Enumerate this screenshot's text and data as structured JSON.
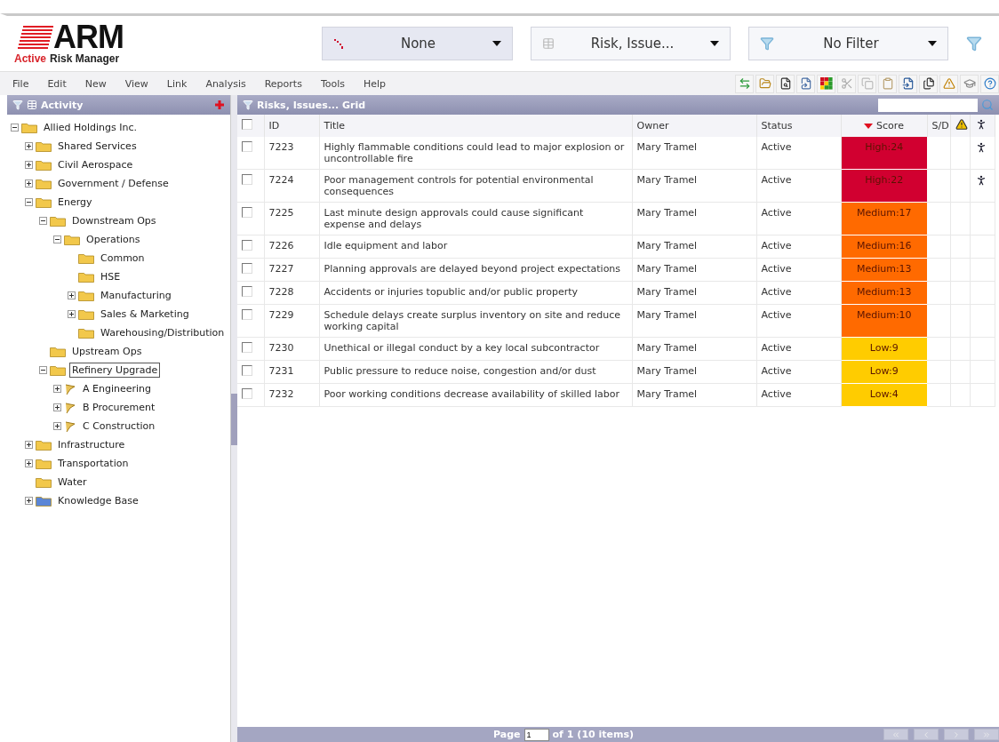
{
  "logo": {
    "mark": "ARM",
    "tagline_1": "Active",
    "tagline_2": "Risk Manager"
  },
  "selectors": [
    {
      "kind": "dots",
      "label": "None",
      "pressed": true
    },
    {
      "kind": "grid",
      "label": "Risk, Issue...",
      "pressed": false
    },
    {
      "kind": "filter",
      "label": "No Filter",
      "pressed": false
    }
  ],
  "menu": [
    "File",
    "Edit",
    "New",
    "View",
    "Link",
    "Analysis",
    "Reports",
    "Tools",
    "Help"
  ],
  "left_panel": {
    "title": "Activity"
  },
  "tree": [
    {
      "label": "Allied Holdings Inc.",
      "kind": "folder",
      "expanded": true,
      "selected": false,
      "children": [
        {
          "label": "Shared Services",
          "kind": "folder",
          "expanded": false,
          "selected": false
        },
        {
          "label": "Civil Aerospace",
          "kind": "folder",
          "expanded": false,
          "selected": false
        },
        {
          "label": "Government / Defense",
          "kind": "folder",
          "expanded": false,
          "selected": false
        },
        {
          "label": "Energy",
          "kind": "folder",
          "expanded": true,
          "selected": false,
          "children": [
            {
              "label": "Downstream Ops",
              "kind": "folder",
              "expanded": true,
              "selected": false,
              "children": [
                {
                  "label": "Operations",
                  "kind": "folder",
                  "expanded": true,
                  "selected": false,
                  "children": [
                    {
                      "label": "Common",
                      "kind": "folder",
                      "selected": false
                    },
                    {
                      "label": "HSE",
                      "kind": "folder",
                      "selected": false
                    },
                    {
                      "label": "Manufacturing",
                      "kind": "folder",
                      "expanded": false,
                      "selected": false
                    },
                    {
                      "label": "Sales & Marketing",
                      "kind": "folder",
                      "expanded": false,
                      "selected": false
                    },
                    {
                      "label": "Warehousing/Distribution",
                      "kind": "folder",
                      "selected": false
                    }
                  ]
                }
              ]
            },
            {
              "label": "Upstream Ops",
              "kind": "folder",
              "selected": false
            },
            {
              "label": "Refinery Upgrade",
              "kind": "folder",
              "expanded": true,
              "selected": true,
              "children": [
                {
                  "label": "A Engineering",
                  "kind": "flag",
                  "expanded": false,
                  "selected": false
                },
                {
                  "label": "B Procurement",
                  "kind": "flag",
                  "expanded": false,
                  "selected": false
                },
                {
                  "label": "C Construction",
                  "kind": "flag",
                  "expanded": false,
                  "selected": false
                }
              ]
            }
          ]
        },
        {
          "label": "Infrastructure",
          "kind": "folder",
          "expanded": false,
          "selected": false
        },
        {
          "label": "Transportation",
          "kind": "folder",
          "expanded": false,
          "selected": false
        },
        {
          "label": "Water",
          "kind": "folder",
          "selected": false
        },
        {
          "label": "Knowledge Base",
          "kind": "library",
          "expanded": false,
          "selected": false
        }
      ]
    }
  ],
  "grid": {
    "title": "Risks, Issues... Grid",
    "all_checked": false,
    "columns": [
      {
        "label": "ID"
      },
      {
        "label": "Title"
      },
      {
        "label": "Owner"
      },
      {
        "label": "Status"
      },
      {
        "label": "Score",
        "sorted": true
      },
      {
        "label": "S/D"
      }
    ],
    "rows": [
      {
        "id": "7223",
        "title": "Highly flammable conditions could lead to major explosion or uncontrollable fire",
        "owner": "Mary Tramel",
        "status": "Active",
        "score": "High:24",
        "color": "#d10030",
        "checked": false,
        "action": true
      },
      {
        "id": "7224",
        "title": "Poor management controls for potential environmental consequences",
        "owner": "Mary Tramel",
        "status": "Active",
        "score": "High:22",
        "color": "#d10030",
        "checked": false,
        "action": true
      },
      {
        "id": "7225",
        "title": "Last minute design approvals could cause significant expense and delays",
        "owner": "Mary Tramel",
        "status": "Active",
        "score": "Medium:17",
        "color": "#ff6a00",
        "checked": false,
        "action": false
      },
      {
        "id": "7226",
        "title": "Idle equipment and labor",
        "owner": "Mary Tramel",
        "status": "Active",
        "score": "Medium:16",
        "color": "#ff6a00",
        "checked": false,
        "action": false
      },
      {
        "id": "7227",
        "title": "Planning approvals are delayed beyond project expectations",
        "owner": "Mary Tramel",
        "status": "Active",
        "score": "Medium:13",
        "color": "#ff6a00",
        "checked": false,
        "action": false
      },
      {
        "id": "7228",
        "title": "Accidents or injuries topublic and/or public property",
        "owner": "Mary Tramel",
        "status": "Active",
        "score": "Medium:13",
        "color": "#ff6a00",
        "checked": false,
        "action": false
      },
      {
        "id": "7229",
        "title": "Schedule delays create surplus inventory on site and reduce working capital",
        "owner": "Mary Tramel",
        "status": "Active",
        "score": "Medium:10",
        "color": "#ff6a00",
        "checked": false,
        "action": false
      },
      {
        "id": "7230",
        "title": "Unethical or illegal conduct by a key local subcontractor",
        "owner": "Mary Tramel",
        "status": "Active",
        "score": "Low:9",
        "color": "#ffcc00",
        "checked": false,
        "action": false
      },
      {
        "id": "7231",
        "title": "Public pressure to reduce noise, congestion and/or dust",
        "owner": "Mary Tramel",
        "status": "Active",
        "score": "Low:9",
        "color": "#ffcc00",
        "checked": false,
        "action": false
      },
      {
        "id": "7232",
        "title": "Poor working conditions decrease availability of skilled labor",
        "owner": "Mary Tramel",
        "status": "Active",
        "score": "Low:4",
        "color": "#ffcc00",
        "checked": false,
        "action": false
      }
    ]
  },
  "pager": {
    "label": "Page",
    "page": "1",
    "of": "of 1",
    "count": "(10 items)"
  }
}
